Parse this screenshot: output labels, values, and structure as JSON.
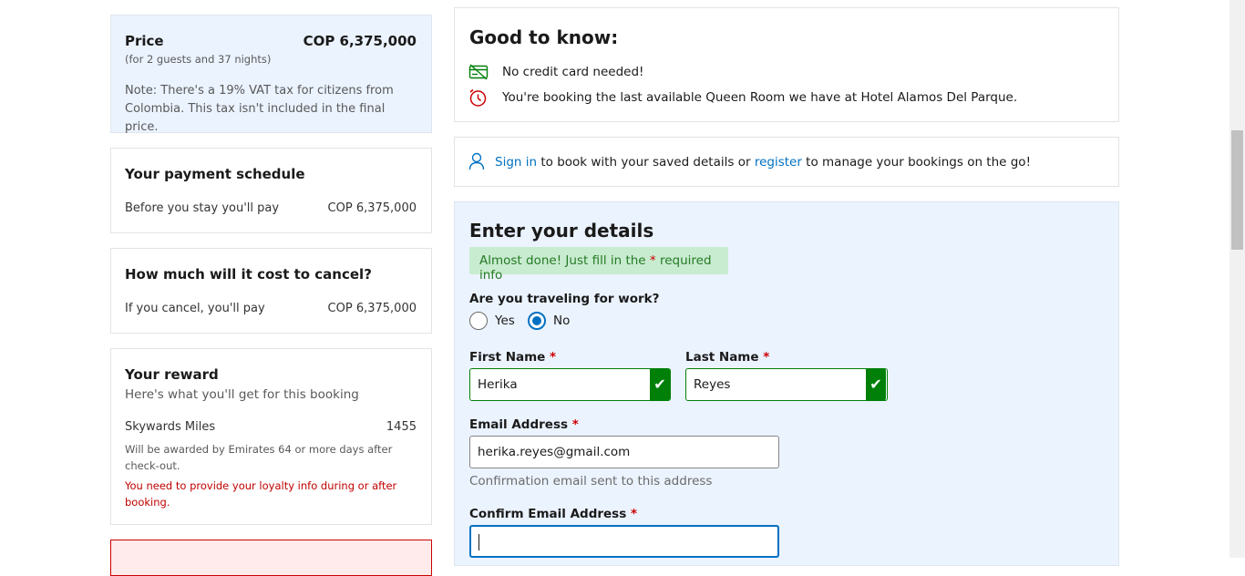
{
  "price": {
    "title": "Price",
    "amount": "COP 6,375,000",
    "subtitle": "(for 2 guests and 37 nights)",
    "note": "Note: There's a 19% VAT tax for citizens from Colombia. This tax isn't included in the final price."
  },
  "schedule": {
    "title": "Your payment schedule",
    "label": "Before you stay you'll pay",
    "amount": "COP 6,375,000"
  },
  "cancel": {
    "title": "How much will it cost to cancel?",
    "label": "If you cancel, you'll pay",
    "amount": "COP 6,375,000"
  },
  "reward": {
    "title": "Your reward",
    "subtitle": "Here's what you'll get for this booking",
    "program": "Skywards Miles",
    "miles": "1455",
    "awarded_note": "Will be awarded by Emirates 64 or more days after check-out.",
    "loyalty_warning": "You need to provide your loyalty info during or after booking."
  },
  "good_to_know": {
    "title": "Good to know:",
    "line1": "No credit card needed!",
    "line2": "You're booking the last available Queen Room we have at Hotel Alamos Del Parque."
  },
  "signin": {
    "link_sign_in": "Sign in",
    "text_middle": "to book with your saved details or",
    "link_register": "register",
    "text_end": "to manage your bookings on the go!"
  },
  "details": {
    "title": "Enter your details",
    "almost_prefix": "Almost done! Just fill in the",
    "almost_star": "*",
    "almost_suffix": "required info",
    "travel_question": "Are you traveling for work?",
    "option_yes": "Yes",
    "option_no": "No",
    "first_name_label": "First Name",
    "first_name_value": "Herika",
    "last_name_label": "Last Name",
    "last_name_value": "Reyes",
    "email_label": "Email Address",
    "email_value": "herika.reyes@gmail.com",
    "email_helper": "Confirmation email sent to this address",
    "confirm_email_label": "Confirm Email Address",
    "confirm_email_value": "",
    "required_star": "*",
    "check": "✔"
  },
  "colors": {
    "link": "#0071c2",
    "success": "#008009",
    "required": "#cc0000"
  }
}
